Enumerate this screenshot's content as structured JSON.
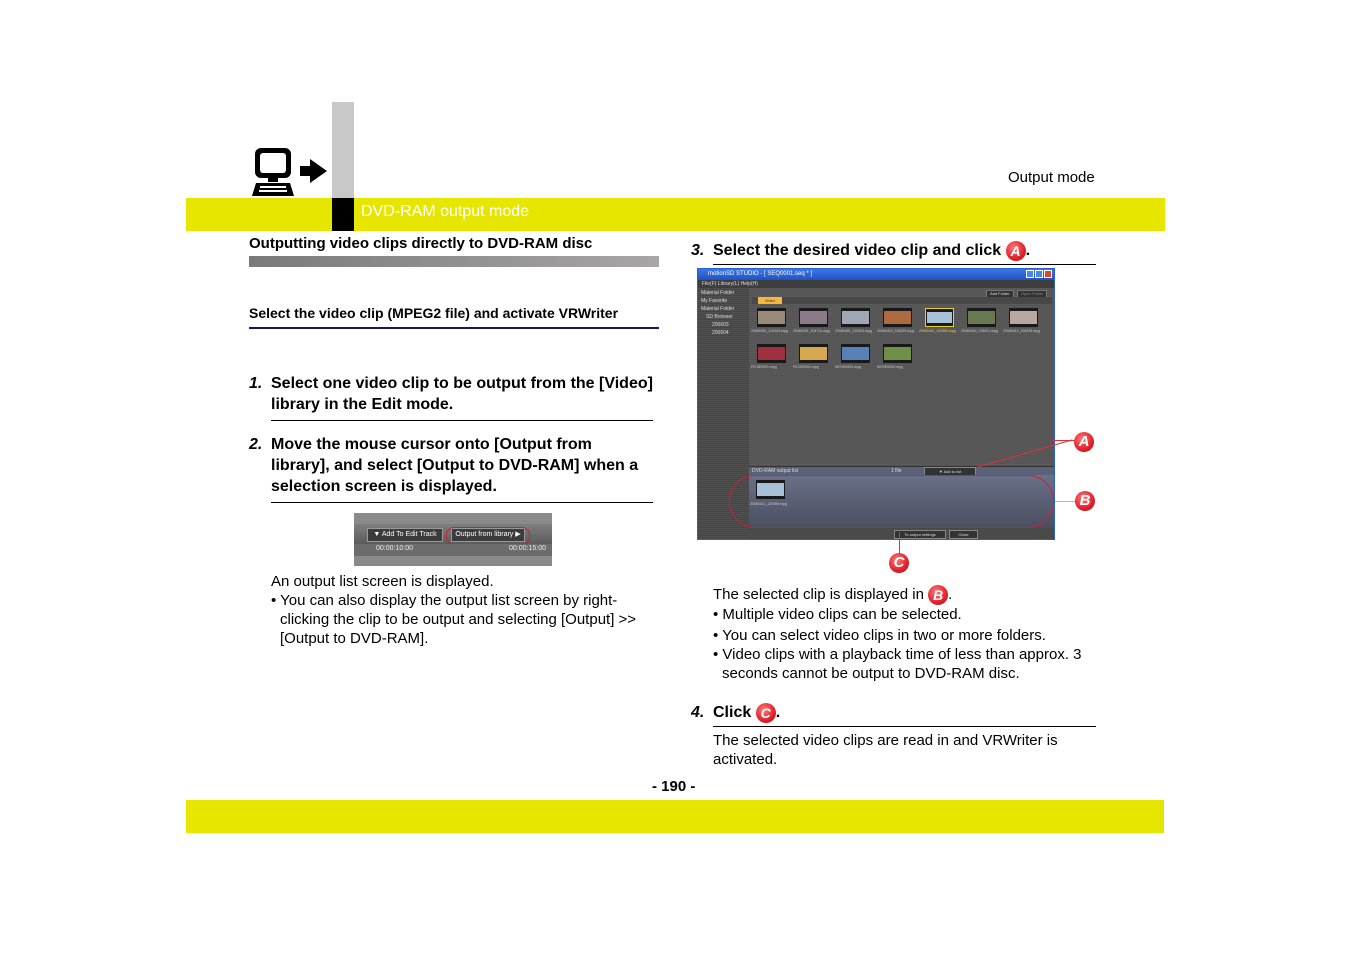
{
  "header": {
    "section_label": "DVD-RAM output mode",
    "mode_label": "Output mode",
    "icon": "computer-output-icon"
  },
  "left": {
    "section_title": "Outputting video clips directly to DVD-RAM disc",
    "subsection_title": "Select the video clip (MPEG2 file) and activate VRWriter",
    "steps": [
      {
        "num": "1.",
        "text": "Select one video clip to be output from the [Video] library in the Edit mode."
      },
      {
        "num": "2.",
        "text": "Move the mouse cursor onto [Output from library], and select [Output to DVD-RAM] when a selection screen is displayed."
      }
    ],
    "mini_screenshot": {
      "add_button": "▼ Add To Edit Track",
      "output_button": "Output from library ▶",
      "time_start": "00:00:10:00",
      "time_end": "00:00:15:00"
    },
    "result_text": "An output list screen is displayed.",
    "bullets": [
      "• You can also display the output list screen by right-clicking the clip to be output and selecting [Output] >> [Output to DVD-RAM]."
    ]
  },
  "right": {
    "step3": {
      "num": "3.",
      "text_before": "Select the desired video clip and click",
      "callout": "A",
      "text_after": "."
    },
    "app": {
      "title": "motionSD STUDIO - [ SEQ0001.seq * ]",
      "menu": "File(F)   Library(L)   Help(H)",
      "material_folder_header": "Material Folder",
      "sidebar": [
        "My Favorite",
        "Material Folder",
        "SD Browser",
        "200603",
        "200604"
      ],
      "add_folder": "Add Folder",
      "open_folder": "Open Folder",
      "tab": "Video",
      "clips": [
        {
          "name": "20060331_101203.mpg",
          "color": "#9a8a7a",
          "selected": false
        },
        {
          "name": "20060331_104711.mpg",
          "color": "#8a7a8a",
          "selected": false
        },
        {
          "name": "20060401_120324.mpg",
          "color": "#a0a8b8",
          "selected": false
        },
        {
          "name": "20060402_234020.mpg",
          "color": "#b06a40",
          "selected": false
        },
        {
          "name": "20060411_120359.mpg",
          "color": "#a8c0d8",
          "selected": true
        },
        {
          "name": "20060414_133021.mpg",
          "color": "#6a7a50",
          "selected": false
        },
        {
          "name": "20060414_133205.mpg",
          "color": "#b8a8a0",
          "selected": false
        },
        {
          "name": "PIC0E0001.mpg",
          "color": "#a03040",
          "selected": false
        },
        {
          "name": "PIC0E0002.mpg",
          "color": "#d8a850",
          "selected": false
        },
        {
          "name": "MOVE0003.mpg",
          "color": "#5a80b8",
          "selected": false
        },
        {
          "name": "MOVE0004.mpg",
          "color": "#70904a",
          "selected": false
        }
      ],
      "output_list_label": "DVD-RAM output list",
      "file_count": "1 file",
      "add_to_list": "▼ Add to list",
      "output_clip": "20060411_120359.mpg",
      "to_output_settings": "To output settings",
      "close": "Close"
    },
    "callouts": {
      "a": "A",
      "b": "B",
      "c": "C"
    },
    "result_text_before": "The selected clip is displayed in",
    "result_callout": "B",
    "result_text_after": ".",
    "bullets": [
      "• Multiple video clips can be selected.",
      "• You can select video clips in two or more folders.",
      "• Video clips with a playback time of less than approx. 3 seconds cannot be output to DVD-RAM disc."
    ],
    "step4": {
      "num": "4.",
      "text_before": "Click",
      "callout": "C",
      "text_after": "."
    },
    "step4_result": "The selected video clips are read in and VRWriter is activated."
  },
  "footer": {
    "page_number": "- 190 -"
  }
}
